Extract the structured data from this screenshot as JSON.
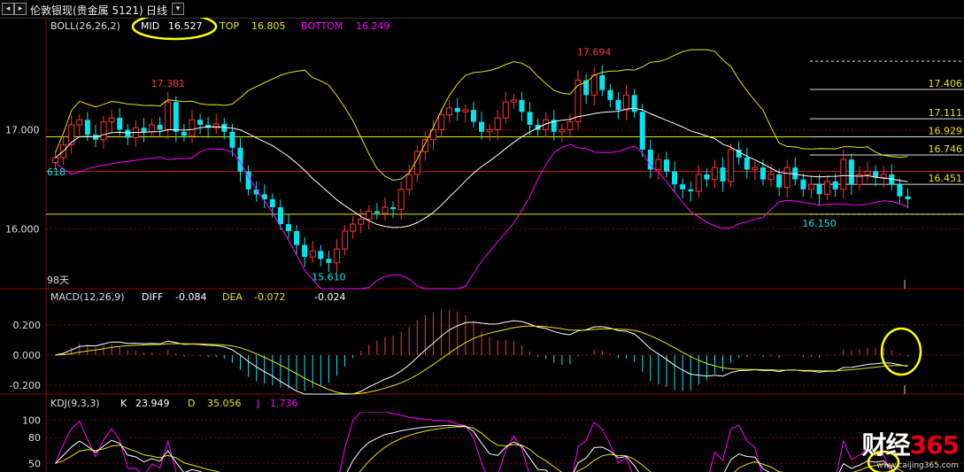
{
  "window": {
    "title": "伦敦银现(贵金属 5121)",
    "period": "日线",
    "buttons": [
      "◂",
      "▸",
      "▾"
    ]
  },
  "boll": {
    "name": "BOLL(26,26,2)",
    "mid_label": "MID",
    "mid": "16.527",
    "top_label": "TOP",
    "top": "16.805",
    "bottom_label": "BOTTOM",
    "bottom": "16.249"
  },
  "macd": {
    "name": "MACD(12,26,9)",
    "diff_label": "DIFF",
    "diff": "-0.084",
    "dea_label": "DEA",
    "dea": "-0.072",
    "macd_value": "-0.024"
  },
  "kdj": {
    "name": "KDJ(9,3,3)",
    "k_label": "K",
    "k": "23.949",
    "d_label": "D",
    "d": "35.056",
    "j_label": "J",
    "j": "1.736"
  },
  "misc": {
    "days_label": "98天",
    "left_618": "618"
  },
  "watermark": {
    "logo_a": "财经",
    "logo_b": "365",
    "url": "www.caijing365.com"
  },
  "colors": {
    "up": "#ff3232",
    "down": "#00e5ee",
    "mid_line": "#ffffff",
    "top_line": "#e6e600",
    "bottom_line": "#ff00ff",
    "gold_line": "#e6e600",
    "highlight_circle": "#ffff00"
  },
  "chart_data": {
    "type": "candlestick",
    "price_axis": {
      "ticks": [
        "17.000",
        "16.000"
      ],
      "ylim": [
        15.4,
        17.95
      ]
    },
    "annotations": [
      {
        "text": "17.381",
        "value": 17.381,
        "bar": 14
      },
      {
        "text": "15.610",
        "value": 15.61,
        "bar": 34
      },
      {
        "text": "17.694",
        "value": 17.694,
        "bar": 67
      },
      {
        "text": "16.150",
        "value": 16.15,
        "bar": 95
      }
    ],
    "fib_levels": [
      {
        "text": "17.406",
        "value": 17.406
      },
      {
        "text": "17.111",
        "value": 17.111
      },
      {
        "text": "16.929",
        "value": 16.929
      },
      {
        "text": "16.746",
        "value": 16.746
      },
      {
        "text": "16.451",
        "value": 16.451
      }
    ],
    "horizontal_lines": [
      {
        "value": 16.929,
        "color": "gold"
      },
      {
        "value": 16.58,
        "color": "red"
      },
      {
        "value": 16.15,
        "color": "gold"
      },
      {
        "value": 16.15,
        "color": "dashed"
      },
      {
        "value": 17.69,
        "color": "dashed"
      }
    ],
    "ohlc_closes": [
      16.72,
      16.85,
      17.05,
      17.1,
      16.95,
      16.9,
      17.08,
      17.12,
      17.0,
      16.92,
      17.02,
      16.98,
      17.05,
      17.0,
      17.28,
      16.98,
      16.94,
      17.1,
      17.05,
      17.02,
      17.06,
      16.98,
      16.82,
      16.58,
      16.4,
      16.35,
      16.3,
      16.22,
      16.05,
      15.98,
      15.84,
      15.72,
      15.78,
      15.7,
      15.66,
      15.8,
      15.98,
      16.05,
      16.1,
      16.18,
      16.16,
      16.22,
      16.2,
      16.4,
      16.55,
      16.78,
      16.9,
      17.0,
      17.15,
      17.22,
      17.18,
      17.2,
      17.08,
      16.98,
      17.0,
      17.12,
      17.28,
      17.3,
      17.18,
      17.05,
      17.0,
      17.1,
      16.98,
      17.0,
      17.08,
      17.5,
      17.35,
      17.55,
      17.4,
      17.3,
      17.2,
      17.35,
      17.18,
      16.8,
      16.6,
      16.7,
      16.58,
      16.45,
      16.4,
      16.38,
      16.55,
      16.5,
      16.62,
      16.48,
      16.8,
      16.72,
      16.6,
      16.62,
      16.5,
      16.55,
      16.42,
      16.62,
      16.5,
      16.4,
      16.45,
      16.35,
      16.48,
      16.4,
      16.7,
      16.45,
      16.55,
      16.58,
      16.52,
      16.55,
      16.45,
      16.33,
      16.3
    ],
    "macd_axis": {
      "ticks": [
        "0.200",
        "0.000",
        "-0.200"
      ],
      "ylim": [
        -0.26,
        0.3
      ]
    },
    "kdj_axis": {
      "ticks": [
        "100",
        "80",
        "50"
      ],
      "ylim": [
        40,
        110
      ]
    }
  }
}
